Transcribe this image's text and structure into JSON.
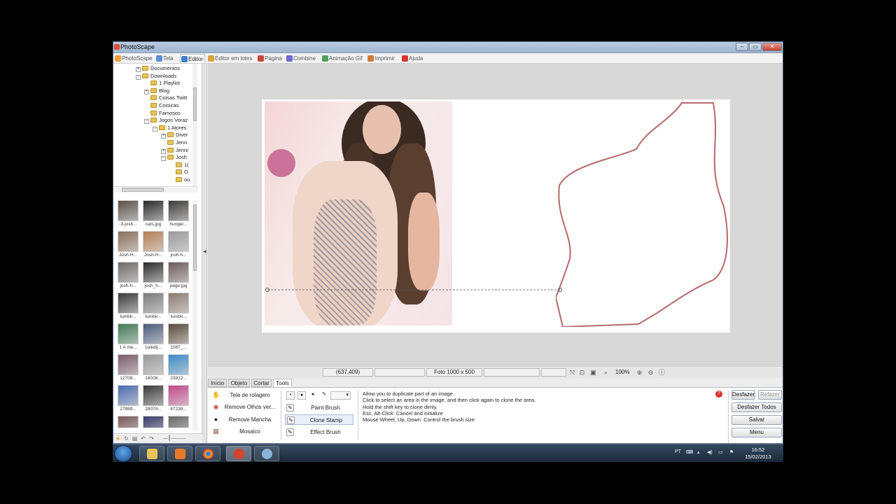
{
  "window": {
    "title": "PhotoScape",
    "min": "‒",
    "max": "▭",
    "close": "✕"
  },
  "tabs": [
    {
      "label": "PhotoScape",
      "color": "#e9a23b"
    },
    {
      "label": "Tela",
      "color": "#5a8fd6"
    },
    {
      "label": "Editor",
      "color": "#3f7fd0"
    },
    {
      "label": "Editor em lotes",
      "color": "#d6a33a"
    },
    {
      "label": "Página",
      "color": "#c8463c"
    },
    {
      "label": "Combine",
      "color": "#6b6bd1"
    },
    {
      "label": "Animação Gif",
      "color": "#4da35a"
    },
    {
      "label": "Imprimir",
      "color": "#d07a3a"
    },
    {
      "label": "Ajuda",
      "color": "#d9332a"
    }
  ],
  "tree": [
    {
      "label": "Documentos",
      "exp": "+"
    },
    {
      "label": "Downloads",
      "exp": "−"
    },
    {
      "label": "1 Playlist",
      "exp": ""
    },
    {
      "label": "Blog",
      "exp": "+"
    },
    {
      "label": "Coisas Twitt",
      "exp": ""
    },
    {
      "label": "Coisicas",
      "exp": ""
    },
    {
      "label": "Famosos",
      "exp": ""
    },
    {
      "label": "Jogos Voraz",
      "exp": "−"
    },
    {
      "label": "1 Atores",
      "exp": "−"
    },
    {
      "label": "Diver",
      "exp": "+"
    },
    {
      "label": "Jenn",
      "exp": ""
    },
    {
      "label": "Jenni",
      "exp": "+"
    },
    {
      "label": "Josh",
      "exp": "−"
    },
    {
      "label": "1(",
      "exp": ""
    },
    {
      "label": "O",
      "exp": ""
    },
    {
      "label": "ou",
      "exp": ""
    }
  ],
  "thumbnails": [
    {
      "caption": "-3-josh...",
      "color": "#5a5048"
    },
    {
      "caption": "cats.jpg",
      "color": "#2a2a2a"
    },
    {
      "caption": "hunger...",
      "color": "#3b3a37"
    },
    {
      "caption": "Josh-H...",
      "color": "#8a6f5a"
    },
    {
      "caption": "Josh-H...",
      "color": "#b57f57"
    },
    {
      "caption": "josh-h...",
      "color": "#9a9a9a"
    },
    {
      "caption": "josh-h...",
      "color": "#6e6a66"
    },
    {
      "caption": "josh_h...",
      "color": "#2b2b2b"
    },
    {
      "caption": "page.jpg",
      "color": "#6d5a5a"
    },
    {
      "caption": "tumblr...",
      "color": "#3a3a3a"
    },
    {
      "caption": "tumblr...",
      "color": "#7a7a7a"
    },
    {
      "caption": "tumblr...",
      "color": "#8d7d72"
    },
    {
      "caption": "1 A me...",
      "color": "#3f7a55"
    },
    {
      "caption": "1oikdtj...",
      "color": "#4b5a7a"
    },
    {
      "caption": "1087_...",
      "color": "#5a4a3a"
    },
    {
      "caption": "12708...",
      "color": "#7a5a6a"
    },
    {
      "caption": "16028...",
      "color": "#9a9a9a"
    },
    {
      "caption": "23912...",
      "color": "#3a8ac6"
    },
    {
      "caption": "27889...",
      "color": "#4a6ab0"
    },
    {
      "caption": "28074...",
      "color": "#3a3a3a"
    },
    {
      "caption": "47238...",
      "color": "#c24a8a"
    },
    {
      "caption": "",
      "color": "#7a5a5a"
    },
    {
      "caption": "",
      "color": "#3a3a6a"
    },
    {
      "caption": "",
      "color": "#6a6a6a"
    }
  ],
  "status": {
    "coords": "(637,409)",
    "photo_info": "Foto 1000 x 500",
    "zoom": "100%"
  },
  "bottom_tabs": [
    "Início",
    "Objeto",
    "Cortar",
    "Tools"
  ],
  "left_tools": [
    "Tela de rolagem",
    "Remove Olhos ver...",
    "Remove Mancha",
    "Mosaico"
  ],
  "brushes": [
    "Paint Brush",
    "Clone Stamp",
    "Effect Brush"
  ],
  "help_lines": [
    "Allow you to duplicate part of an image.",
    "Click to select an area in the image, and then click again to clone the area.",
    "Hold the shift key to clone dimly.",
    "Esc, Alt-Click: Cancel and initialize",
    "Mouse Wheel, Up, Down: Control the brush size"
  ],
  "right_buttons": {
    "undo": "Desfazer",
    "redo": "Refazer",
    "undo_all": "Desfazer Todos",
    "save": "Salvar",
    "menu": "Menu"
  },
  "taskbar": {
    "language": "PT",
    "time": "16:52",
    "date": "15/02/2013"
  }
}
